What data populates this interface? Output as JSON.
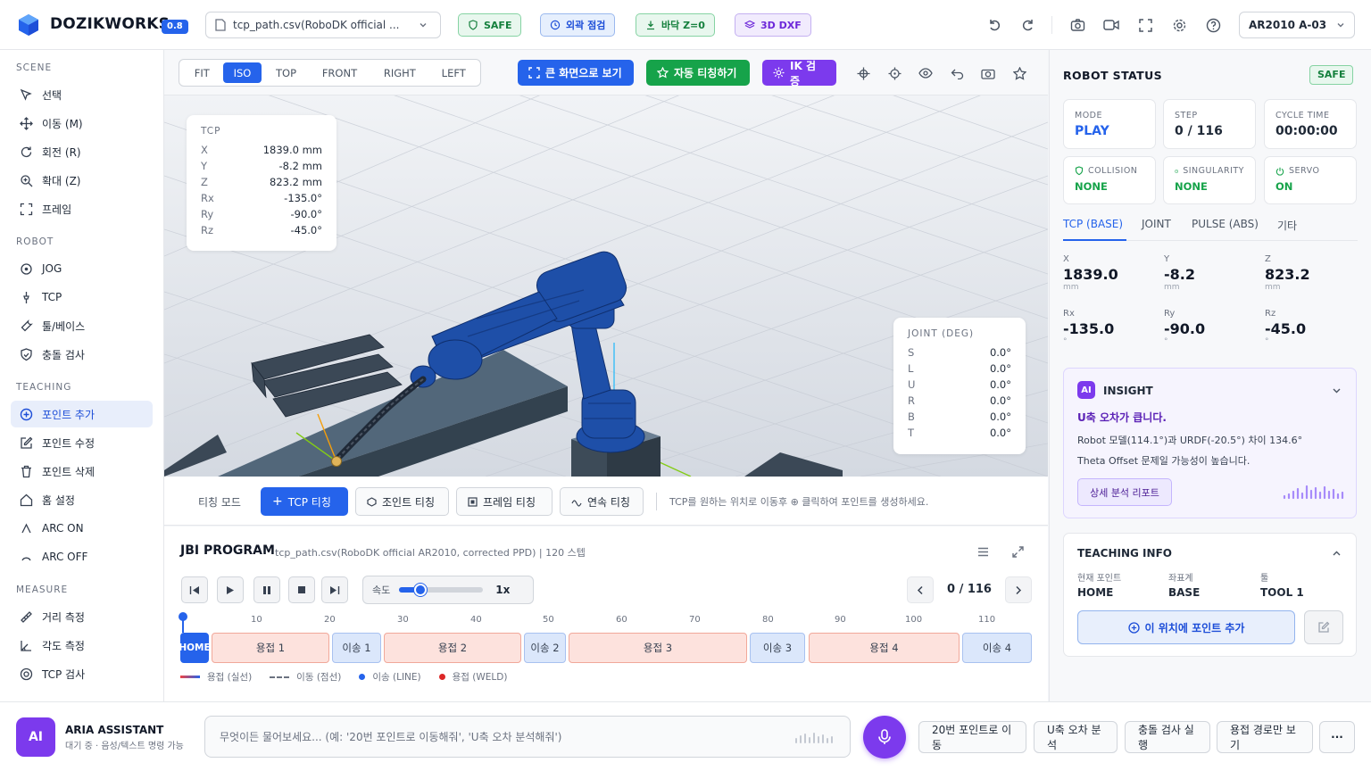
{
  "app": {
    "name": "DOZIKWORKS",
    "version": "0.8"
  },
  "header": {
    "file": "tcp_path.csv(RoboDK official ...",
    "chips": [
      "SAFE",
      "외곽 점검",
      "바닥 Z=0",
      "3D DXF"
    ],
    "robot": "AR2010 A-03"
  },
  "sidebar": {
    "scene_title": "SCENE",
    "scene": [
      "선택",
      "이동 (M)",
      "회전 (R)",
      "확대 (Z)",
      "프레임"
    ],
    "robot_title": "ROBOT",
    "robot": [
      "JOG",
      "TCP",
      "툴/베이스",
      "충돌 검사"
    ],
    "teaching_title": "TEACHING",
    "teaching": [
      "포인트 추가",
      "포인트 수정",
      "포인트 삭제",
      "홈 설정",
      "ARC ON",
      "ARC OFF"
    ],
    "measure_title": "MEASURE",
    "measure": [
      "거리 측정",
      "각도 측정",
      "TCP 검사"
    ]
  },
  "view": {
    "modes": [
      "FIT",
      "ISO",
      "TOP",
      "FRONT",
      "RIGHT",
      "LEFT"
    ],
    "active_mode": "ISO",
    "fullscreen": "큰 화면으로 보기",
    "auto_teach": "자동 티칭하기",
    "ik_check": "IK 검증"
  },
  "tcp_overlay": {
    "title": "TCP",
    "rows": [
      {
        "label": "X",
        "value": "1839.0 mm"
      },
      {
        "label": "Y",
        "value": "-8.2 mm"
      },
      {
        "label": "Z",
        "value": "823.2 mm"
      },
      {
        "label": "Rx",
        "value": "-135.0°"
      },
      {
        "label": "Ry",
        "value": "-90.0°"
      },
      {
        "label": "Rz",
        "value": "-45.0°"
      }
    ]
  },
  "joint_overlay": {
    "title": "JOINT (DEG)",
    "rows": [
      {
        "label": "S",
        "value": "0.0°"
      },
      {
        "label": "L",
        "value": "0.0°"
      },
      {
        "label": "U",
        "value": "0.0°"
      },
      {
        "label": "R",
        "value": "0.0°"
      },
      {
        "label": "B",
        "value": "0.0°"
      },
      {
        "label": "T",
        "value": "0.0°"
      }
    ]
  },
  "teaching_bar": {
    "mode_label": "티칭 모드",
    "tcp": "TCP 티칭",
    "joint": "조인트 티칭",
    "frame": "프레임 티칭",
    "continuous": "연속 티칭",
    "hint": "TCP를 원하는 위치로 이동후 ⊕ 클릭하여 포인트를 생성하세요."
  },
  "program": {
    "title": "JBI PROGRAM",
    "subtitle": "tcp_path.csv(RoboDK official AR2010, corrected PPD) | 120 스텝",
    "speed_label": "속도",
    "speed_value": "1x",
    "speed_fraction": 0.25,
    "step": "0 / 116",
    "ticks": [
      "10",
      "20",
      "30",
      "40",
      "50",
      "60",
      "70",
      "80",
      "90",
      "100",
      "110"
    ],
    "segments": [
      "HOME",
      "용접 1",
      "이송 1",
      "용접 2",
      "이송 2",
      "용접 3",
      "이송 3",
      "용접 4",
      "이송 4"
    ],
    "legend": [
      "용접 (실선)",
      "이동 (점선)",
      "이송 (LINE)",
      "용접 (WELD)"
    ]
  },
  "status": {
    "title": "ROBOT STATUS",
    "badge": "SAFE",
    "cards": [
      {
        "label": "MODE",
        "value": "PLAY"
      },
      {
        "label": "STEP",
        "value": "0 / 116"
      },
      {
        "label": "CYCLE TIME",
        "value": "00:00:00"
      },
      {
        "label": "COLLISION",
        "value": "NONE"
      },
      {
        "label": "SINGULARITY",
        "value": "NONE"
      },
      {
        "label": "SERVO",
        "value": "ON"
      }
    ],
    "tabs": [
      "TCP (BASE)",
      "JOINT",
      "PULSE (ABS)",
      "기타"
    ],
    "values": [
      {
        "label": "X",
        "value": "1839.0",
        "unit": "mm"
      },
      {
        "label": "Y",
        "value": "-8.2",
        "unit": "mm"
      },
      {
        "label": "Z",
        "value": "823.2",
        "unit": "mm"
      },
      {
        "label": "Rx",
        "value": "-135.0",
        "unit": "°"
      },
      {
        "label": "Ry",
        "value": "-90.0",
        "unit": "°"
      },
      {
        "label": "Rz",
        "value": "-45.0",
        "unit": "°"
      }
    ]
  },
  "insight": {
    "badge": "AI",
    "title": "INSIGHT",
    "headline": "U축 오차가 큽니다.",
    "line1": "Robot 모델(114.1°)과 URDF(-20.5°) 차이 134.6°",
    "line2": "Theta Offset 문제일 가능성이 높습니다.",
    "button": "상세 분석 리포트"
  },
  "teaching_info": {
    "title": "TEACHING INFO",
    "cols": [
      {
        "label": "현재 포인트",
        "value": "HOME"
      },
      {
        "label": "좌표계",
        "value": "BASE"
      },
      {
        "label": "툴",
        "value": "TOOL 1"
      }
    ],
    "add_button": "이 위치에 포인트 추가"
  },
  "assistant": {
    "avatar": "AI",
    "name": "ARIA ASSISTANT",
    "status": "대기 중 · 음성/텍스트 명령 가능",
    "placeholder": "무엇이든 물어보세요... (예: '20번 포인트로 이동해줘', 'U축 오차 분석해줘')",
    "quick": [
      "20번 포인트로 이동",
      "U축 오차 분석",
      "충돌 검사 실행",
      "용접 경로만 보기"
    ],
    "more": "···"
  },
  "colors": {
    "accent": "#2563eb",
    "green": "#16a34a",
    "purple": "#7c3aed",
    "robot": "#1e4fa8"
  }
}
